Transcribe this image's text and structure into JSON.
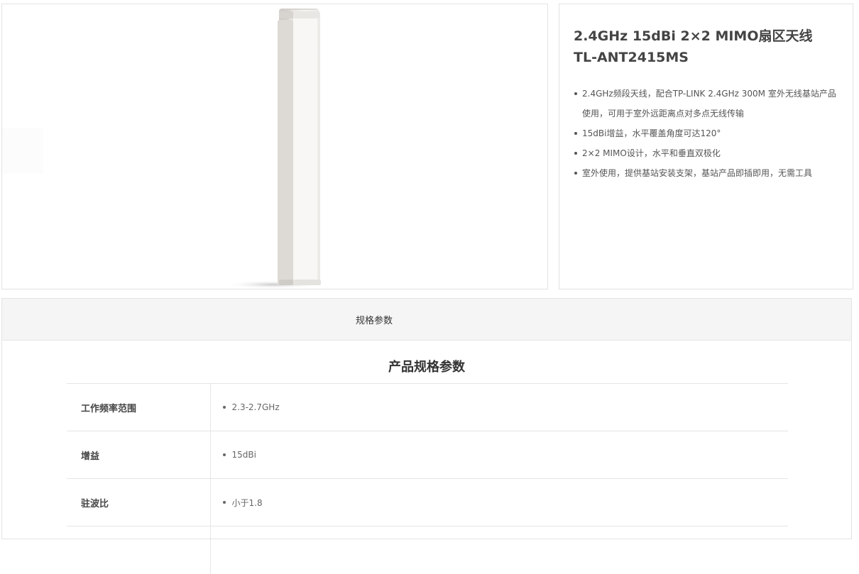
{
  "product": {
    "title_line1": "2.4GHz 15dBi 2×2 MIMO扇区天线",
    "title_line2": "TL-ANT2415MS",
    "features": [
      "2.4GHz频段天线，配合TP-LINK 2.4GHz 300M 室外无线基站产品使用，可用于室外远距离点对多点无线传输",
      "15dBi增益，水平覆盖角度可达120°",
      "2×2 MIMO设计，水平和垂直双极化",
      "室外使用，提供基站安装支架，基站产品即插即用，无需工具"
    ]
  },
  "tabs": {
    "specs_label": "规格参数"
  },
  "specs": {
    "heading": "产品规格参数",
    "rows": [
      {
        "key": "工作频率范围",
        "value": "2.3-2.7GHz"
      },
      {
        "key": "增益",
        "value": "15dBi"
      },
      {
        "key": "驻波比",
        "value": "小于1.8"
      }
    ]
  }
}
